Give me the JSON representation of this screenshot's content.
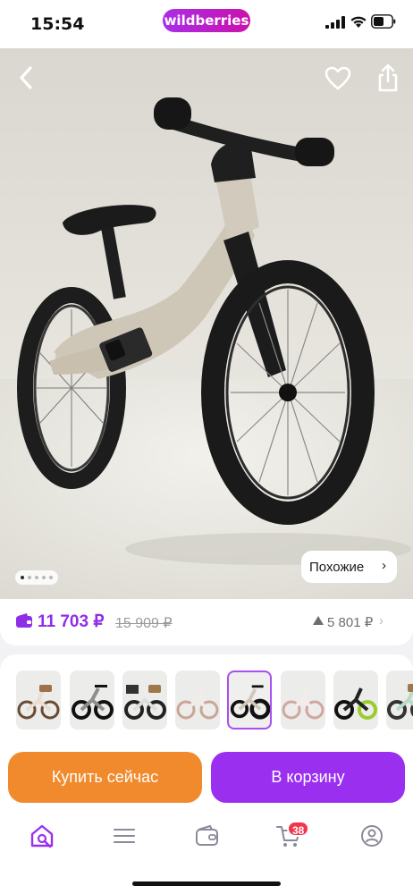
{
  "status_bar": {
    "time": "15:54",
    "brand": "wildberries",
    "icons": [
      "signal-icon",
      "wifi-icon",
      "battery-icon"
    ]
  },
  "product_gallery": {
    "image": "balance-bike-photo",
    "current_slide": 1,
    "total_dots": 5,
    "similar_label": "Похожие",
    "actions": [
      "back-icon",
      "heart-icon",
      "share-icon"
    ]
  },
  "price": {
    "current": "11 703 ₽",
    "old": "15 909 ₽",
    "drop": "5 801 ₽"
  },
  "thumbnails": {
    "count": 8,
    "selected_index": 4,
    "variants": [
      "beige-basket",
      "gray-black",
      "checkered-basket",
      "beige-white",
      "beige-black",
      "pink-white",
      "black-green",
      "mint-basket"
    ]
  },
  "actions": {
    "buy_now": "Купить сейчас",
    "add_to_cart": "В корзину"
  },
  "tab_bar": {
    "items": [
      "home-search-icon",
      "catalog-icon",
      "wallet-icon",
      "cart-icon",
      "profile-icon"
    ],
    "active": "home-search-icon",
    "cart_badge": "38"
  },
  "colors": {
    "brand_purple": "#9b2ff0",
    "price_purple": "#8f2ee8",
    "buy_orange": "#f18a2c",
    "badge_red": "#f2354d"
  }
}
